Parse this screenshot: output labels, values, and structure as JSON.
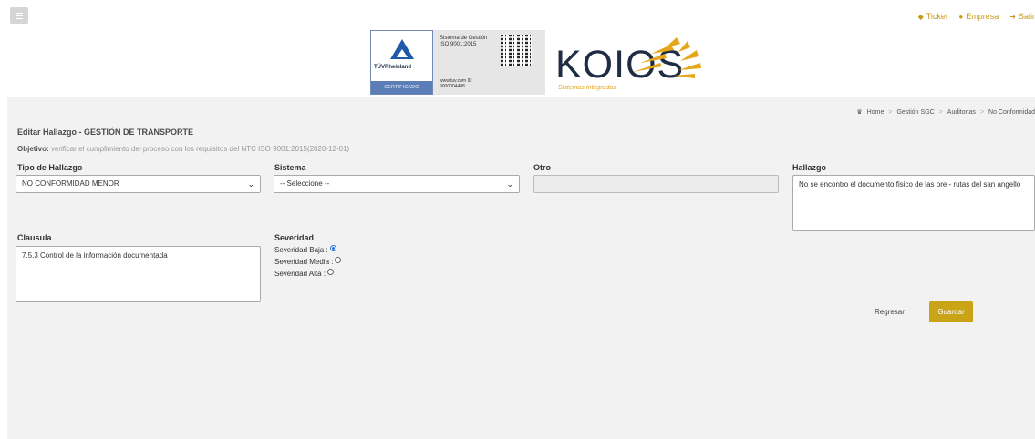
{
  "header": {
    "links": [
      {
        "icon": "tag-icon",
        "label": "Ticket"
      },
      {
        "icon": "user-icon",
        "label": "Empresa"
      },
      {
        "icon": "sign-out-icon",
        "label": "Salir"
      }
    ],
    "accent_color": "#c79a12"
  },
  "banner": {
    "tuv_name": "TÜVRheinland",
    "tuv_cert": "CERTIFICADO",
    "iso_text": "Sistema de Gestión ISO 9001:2015",
    "iso_web": "www.tuv.com ID 9000004488",
    "brand": "KOIOS",
    "brand_sub": "Sistemas Integrados"
  },
  "breadcrumb": {
    "items": [
      "Home",
      "Gestión SGC",
      "Auditorias",
      "No Conformidad"
    ]
  },
  "page": {
    "title": "Editar Hallazgo - GESTIÓN DE TRANSPORTE",
    "objetivo_label": "Objetivo:",
    "objetivo_text": "verificar el cumplimiento del proceso con los requisitos del NTC ISO 9001:2015(2020-12-01)"
  },
  "form": {
    "tipo_label": "Tipo de Hallazgo",
    "tipo_value": "NO CONFORMIDAD MENOR",
    "sistema_label": "Sistema",
    "sistema_value": "-- Seleccione --",
    "otro_label": "Otro",
    "hallazgo_label": "Hallazgo",
    "hallazgo_value": "No se encontro el documento fisico de las pre - rutas del san angello",
    "clausula_label": "Clausula",
    "clausula_value": "7.5.3 Control de la información documentada",
    "severidad_label": "Severidad",
    "severidad_options": [
      {
        "label": "Severidad Baja :",
        "selected": true
      },
      {
        "label": "Severidad Media :",
        "selected": false
      },
      {
        "label": "Severidad Alta :",
        "selected": false
      }
    ]
  },
  "actions": {
    "back_label": "Regresar",
    "save_label": "Guardar",
    "save_color": "#c9a417"
  }
}
